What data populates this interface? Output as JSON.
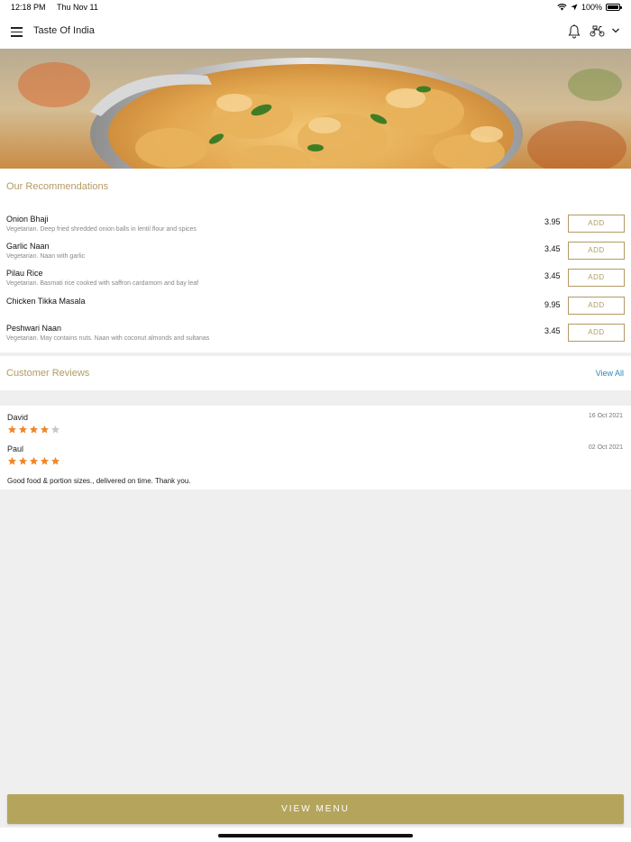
{
  "status_bar": {
    "time": "12:18 PM",
    "date": "Thu Nov 11",
    "battery": "100%"
  },
  "nav": {
    "title": "Taste Of India"
  },
  "recommendations": {
    "title": "Our Recommendations",
    "add_label": "ADD",
    "items": [
      {
        "name": "Onion Bhaji",
        "description": "Vegetarian. Deep fried shredded onion balls in lentil flour and spices",
        "price": "3.95"
      },
      {
        "name": "Garlic Naan",
        "description": "Vegetarian. Naan with garlic",
        "price": "3.45"
      },
      {
        "name": "Pilau Rice",
        "description": "Vegetarian. Basmati rice cooked with saffron cardamom and bay leaf",
        "price": "3.45"
      },
      {
        "name": "Chicken Tikka Masala",
        "description": "",
        "price": "9.95"
      },
      {
        "name": "Peshwari Naan",
        "description": "Vegetarian. May contains nuts. Naan with coconut almonds and sultanas",
        "price": "3.45"
      }
    ]
  },
  "reviews_section": {
    "title": "Customer Reviews",
    "view_all": "View All"
  },
  "reviews": [
    {
      "name": "David",
      "date": "16 Oct 2021",
      "rating": 4,
      "max_rating": 5,
      "text": ""
    },
    {
      "name": "Paul",
      "date": "02 Oct 2021",
      "rating": 5,
      "max_rating": 5,
      "text": "Good food & portion sizes., delivered on time. Thank you."
    }
  ],
  "bottom": {
    "view_menu": "VIEW MENU"
  },
  "colors": {
    "accent": "#b29b64",
    "button": "#b5a55c",
    "link": "#2a8ab8",
    "star": "#f0862a",
    "star_empty": "#c8c8c8"
  }
}
